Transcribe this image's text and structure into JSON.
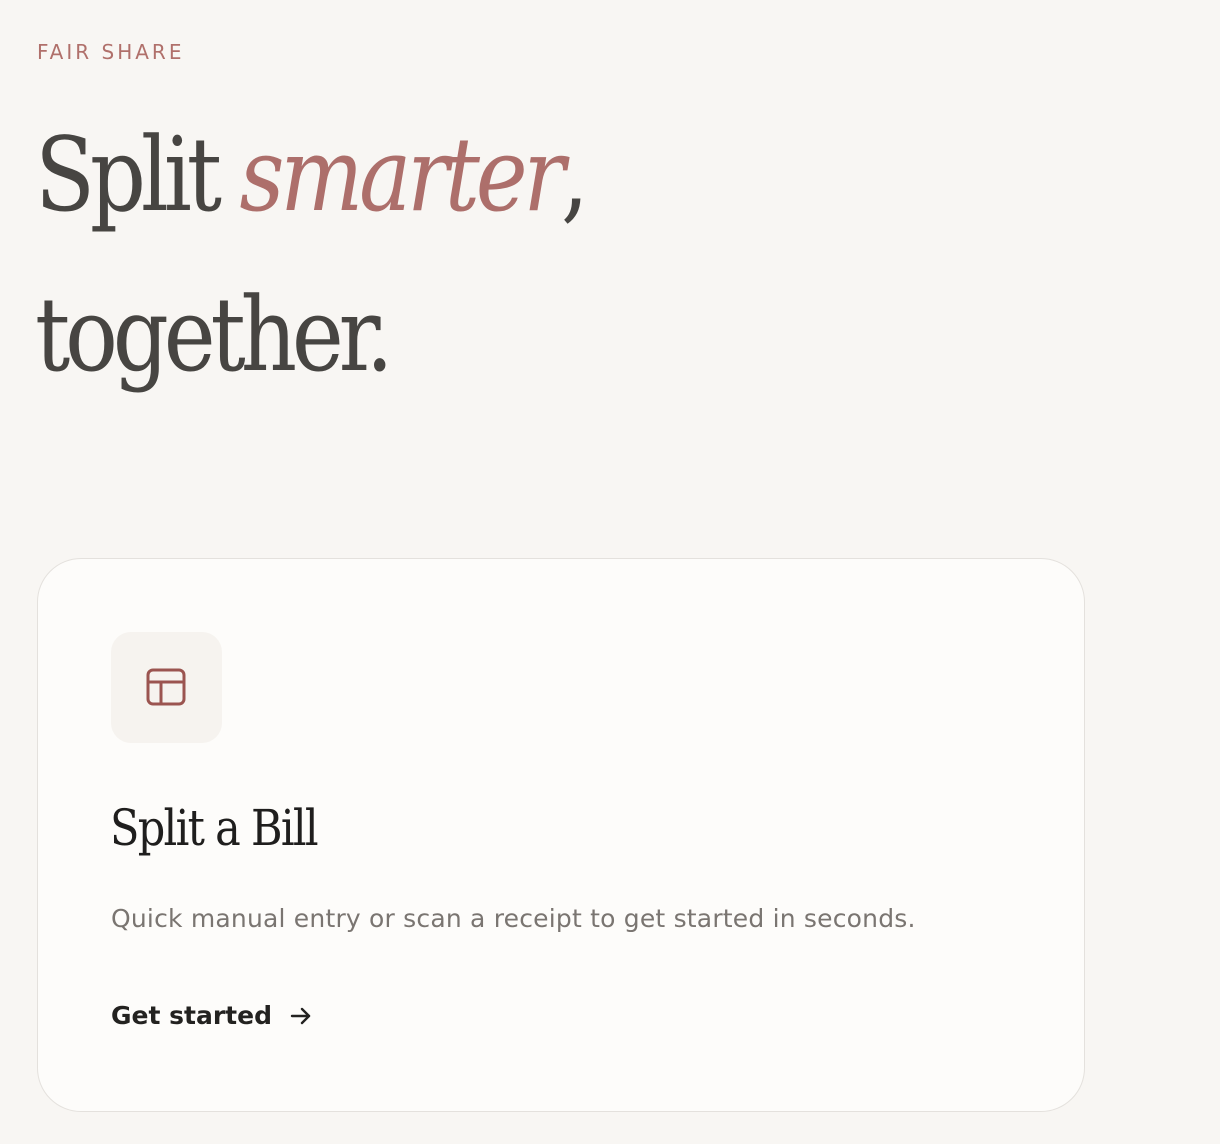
{
  "eyebrow": "FAIR SHARE",
  "hero": {
    "word_1": "Split",
    "word_accent": "smarter",
    "comma": ",",
    "line_2": "together."
  },
  "card": {
    "icon": "table-icon",
    "title": "Split a Bill",
    "description": "Quick manual entry or scan a receipt to get started in seconds.",
    "cta_label": "Get started",
    "cta_icon": "arrow-right-icon"
  },
  "colors": {
    "background": "#f8f6f3",
    "accent": "#ad6f6b",
    "heading": "#474542",
    "card_background": "#fdfcfa",
    "card_border": "#e4e1dd",
    "body_text": "#7a7571"
  }
}
